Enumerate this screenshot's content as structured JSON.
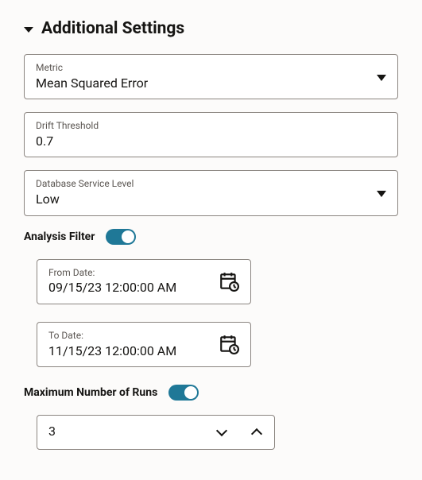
{
  "header": {
    "title": "Additional Settings"
  },
  "metric": {
    "label": "Metric",
    "value": "Mean Squared Error"
  },
  "drift_threshold": {
    "label": "Drift Threshold",
    "value": "0.7"
  },
  "db_service_level": {
    "label": "Database Service Level",
    "value": "Low"
  },
  "analysis_filter": {
    "label": "Analysis Filter",
    "enabled": true
  },
  "from_date": {
    "label": "From Date:",
    "value": "09/15/23 12:00:00 AM"
  },
  "to_date": {
    "label": "To Date:",
    "value": "11/15/23 12:00:00 AM"
  },
  "max_runs": {
    "label": "Maximum Number of Runs",
    "enabled": true,
    "value": "3"
  }
}
